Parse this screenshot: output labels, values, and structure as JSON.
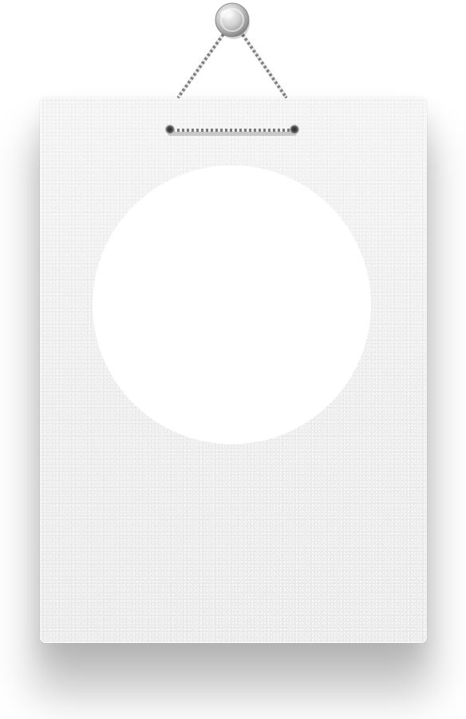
{
  "scene": {
    "description_label": "",
    "card": {
      "color": "#efefef",
      "texture": "paper"
    },
    "photo_slot": {
      "color": "#ffffff",
      "shape": "circle",
      "content": ""
    },
    "hanger": {
      "pin": "metal-pin",
      "cord": "twisted-cord"
    }
  }
}
